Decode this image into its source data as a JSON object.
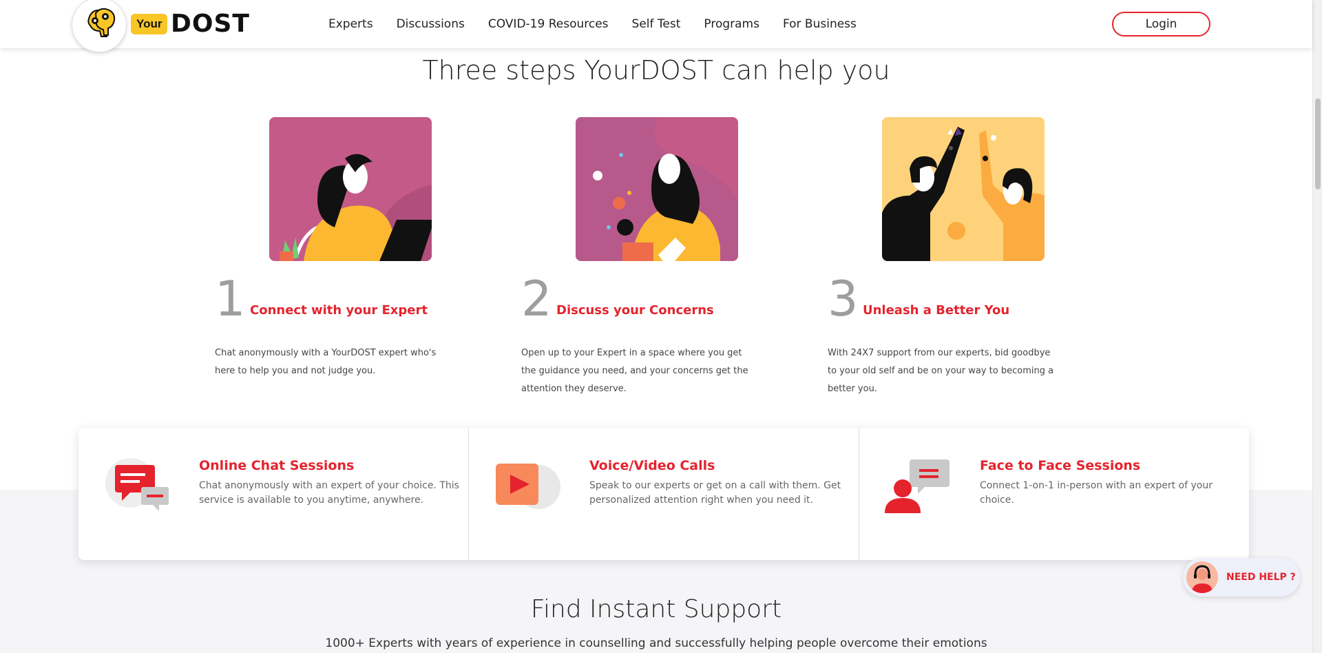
{
  "header": {
    "logo_badge": "Your",
    "logo_word": "DOST",
    "nav": [
      "Experts",
      "Discussions",
      "COVID-19 Resources",
      "Self Test",
      "Programs",
      "For Business"
    ],
    "login_label": "Login"
  },
  "steps": {
    "title": "Three steps YourDOST can help you",
    "items": [
      {
        "num": "1",
        "title": "Connect with your Expert",
        "desc": "Chat anonymously with a YourDOST expert who's here to help you and not judge you."
      },
      {
        "num": "2",
        "title": "Discuss your Concerns",
        "desc": "Open up to your Expert in a space where you get the guidance you need, and your concerns get the attention they deserve."
      },
      {
        "num": "3",
        "title": "Unleash a Better You",
        "desc": "With 24X7 support from our experts, bid goodbye to your old self and be on your way to becoming a better you."
      }
    ]
  },
  "services": [
    {
      "icon": "chat-bubbles-icon",
      "title": "Online Chat Sessions",
      "desc": "Chat anonymously with an expert of your choice. This service is available to you anytime, anywhere."
    },
    {
      "icon": "video-play-icon",
      "title": "Voice/Video Calls",
      "desc": "Speak to our experts or get on a call with them. Get personalized attention right when you need it."
    },
    {
      "icon": "person-chat-icon",
      "title": "Face to Face Sessions",
      "desc": "Connect 1-on-1 in-person with an expert of your choice."
    }
  ],
  "support": {
    "title": "Find Instant Support",
    "subtitle": "1000+ Experts with years of experience in counselling and successfully helping people overcome their emotions"
  },
  "need_help": {
    "label": "NEED HELP ?"
  },
  "colors": {
    "accent": "#e5232d",
    "brand_yellow": "#f9c628",
    "gray_band": "#f5f5f8"
  }
}
